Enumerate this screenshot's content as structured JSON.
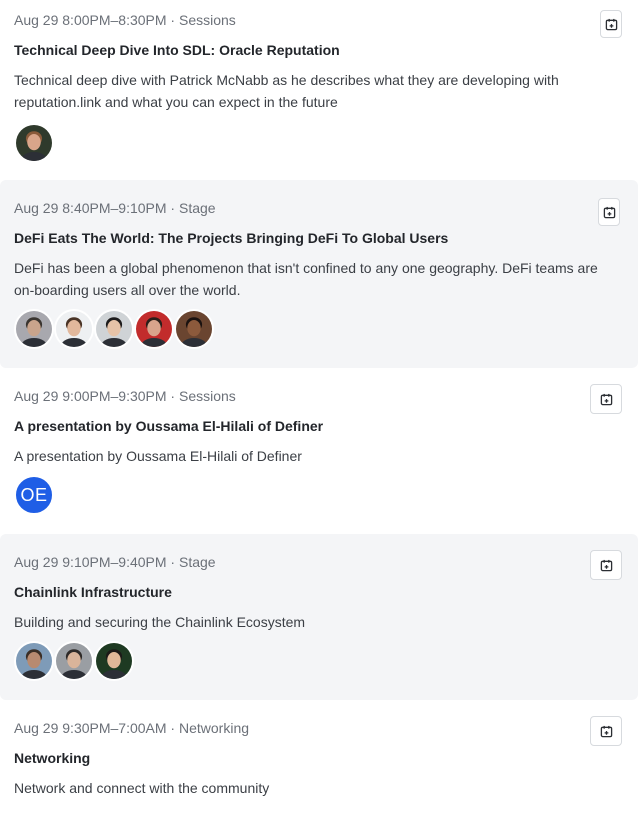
{
  "sessions": [
    {
      "time": "Aug 29 8:00PM–8:30PM · Sessions",
      "title": "Technical Deep Dive Into SDL: Oracle Reputation",
      "description": "Technical deep dive with Patrick McNabb as he describes what they are developing with reputation.link and what you can expect in the future",
      "speakers": [
        {
          "kind": "photo",
          "skin": "#d9a58a",
          "hair": "#8a5a3a",
          "bg": "#2f3a2c"
        }
      ]
    },
    {
      "time": "Aug 29 8:40PM–9:10PM · Stage",
      "title": "DeFi Eats The World: The Projects Bringing DeFi To Global Users",
      "description": "DeFi has been a global phenomenon that isn't confined to any one geography. DeFi teams are on-boarding users all over the world.",
      "speakers": [
        {
          "kind": "photo",
          "skin": "#c9a48c",
          "hair": "#3a3530",
          "bg": "#a8a8ae"
        },
        {
          "kind": "photo",
          "skin": "#e2b89c",
          "hair": "#4a3426",
          "bg": "#eef0f2"
        },
        {
          "kind": "photo",
          "skin": "#e6c3a8",
          "hair": "#1e1c1c",
          "bg": "#cfd3d6"
        },
        {
          "kind": "photo",
          "skin": "#d8a48c",
          "hair": "#2a1f1a",
          "bg": "#c22c2c"
        },
        {
          "kind": "photo",
          "skin": "#8c5a3c",
          "hair": "#1a1210",
          "bg": "#6a4530"
        }
      ]
    },
    {
      "time": "Aug 29 9:00PM–9:30PM · Sessions",
      "title": "A presentation by Oussama El-Hilali of Definer",
      "description": "A presentation by Oussama El-Hilali of Definer",
      "speakers": [
        {
          "kind": "initials",
          "text": "OE"
        }
      ]
    },
    {
      "time": "Aug 29 9:10PM–9:40PM · Stage",
      "title": "Chainlink Infrastructure",
      "description": "Building and securing the Chainlink Ecosystem",
      "speakers": [
        {
          "kind": "photo",
          "skin": "#b88a70",
          "hair": "#3a2e26",
          "bg": "#7e9bb8"
        },
        {
          "kind": "photo",
          "skin": "#d9b49a",
          "hair": "#2e2a28",
          "bg": "#9a9ea3"
        },
        {
          "kind": "photo",
          "skin": "#e0b898",
          "hair": "#1c1a18",
          "bg": "#1e3a22"
        }
      ]
    },
    {
      "time": "Aug 29 9:30PM–7:00AM · Networking",
      "title": "Networking",
      "description": "Network and connect with the community",
      "speakers": []
    }
  ],
  "icons": {
    "add_to_calendar": "calendar-add-icon"
  },
  "colors": {
    "alt_row": "#f4f5f7",
    "initials_avatar": "#1f5ee6"
  }
}
